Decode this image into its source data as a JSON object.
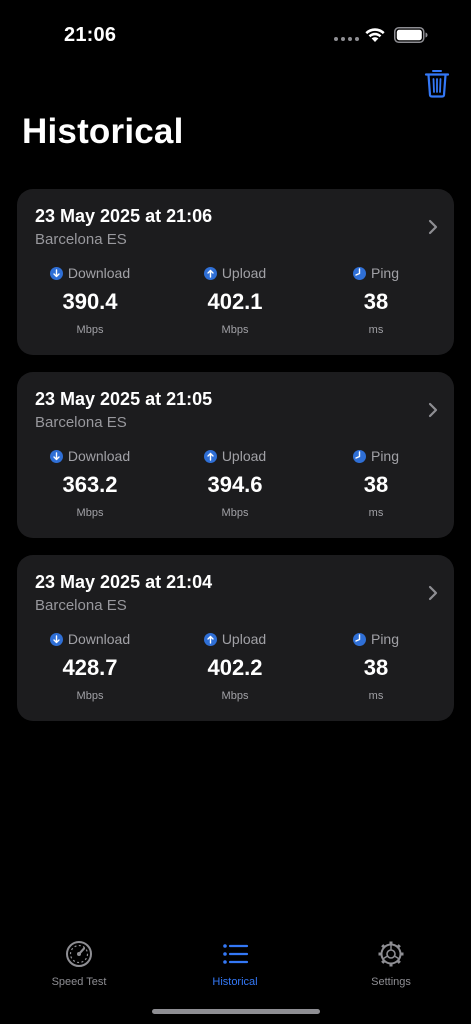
{
  "status_bar": {
    "time": "21:06"
  },
  "header": {
    "title": "Historical",
    "delete_icon": "trash-icon"
  },
  "labels": {
    "download": "Download",
    "upload": "Upload",
    "ping": "Ping",
    "speed_unit": "Mbps",
    "ping_unit": "ms"
  },
  "results": [
    {
      "date": "23 May 2025 at 21:06",
      "location": "Barcelona ES",
      "download": "390.4",
      "upload": "402.1",
      "ping": "38"
    },
    {
      "date": "23 May 2025 at 21:05",
      "location": "Barcelona ES",
      "download": "363.2",
      "upload": "394.6",
      "ping": "38"
    },
    {
      "date": "23 May 2025 at 21:04",
      "location": "Barcelona ES",
      "download": "428.7",
      "upload": "402.2",
      "ping": "38"
    }
  ],
  "tabs": [
    {
      "label": "Speed Test",
      "icon": "speedometer-icon",
      "active": false
    },
    {
      "label": "Historical",
      "icon": "list-icon",
      "active": true
    },
    {
      "label": "Settings",
      "icon": "gear-icon",
      "active": false
    }
  ],
  "colors": {
    "accent": "#3478f6",
    "card": "#1c1c1e",
    "background": "#000000"
  }
}
